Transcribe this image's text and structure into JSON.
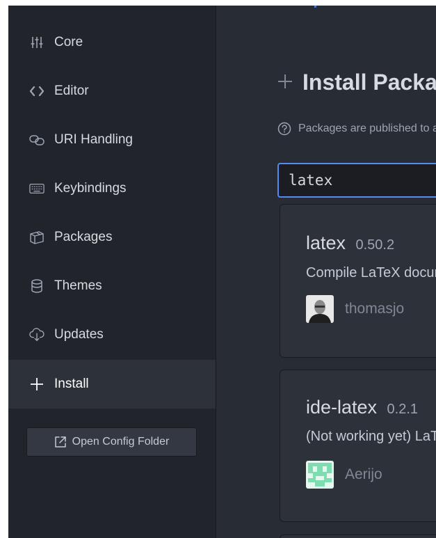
{
  "sidebar": {
    "items": [
      {
        "label": "Core",
        "icon": "sliders-icon"
      },
      {
        "label": "Editor",
        "icon": "code-icon"
      },
      {
        "label": "URI Handling",
        "icon": "link-icon"
      },
      {
        "label": "Keybindings",
        "icon": "keyboard-icon"
      },
      {
        "label": "Packages",
        "icon": "package-icon"
      },
      {
        "label": "Themes",
        "icon": "paintcan-icon"
      },
      {
        "label": "Updates",
        "icon": "cloud-download-icon"
      },
      {
        "label": "Install",
        "icon": "plus-icon",
        "active": true
      }
    ],
    "open_config_label": "Open Config Folder"
  },
  "main": {
    "title": "Install Packages",
    "info_text": "Packages are published to atom.io",
    "search": {
      "value": "latex"
    },
    "packages": [
      {
        "name": "latex",
        "version": "0.50.2",
        "description": "Compile LaTeX documents from within Atom",
        "owner": "thomasjo"
      },
      {
        "name": "ide-latex",
        "version": "0.2.1",
        "description": "(Not working yet) LaTeX language support",
        "owner": "Aerijo"
      }
    ]
  },
  "colors": {
    "accent": "#568af2",
    "sidebar_bg": "#21252b",
    "panel_bg": "#282c34",
    "card_bg": "#2c313a"
  }
}
